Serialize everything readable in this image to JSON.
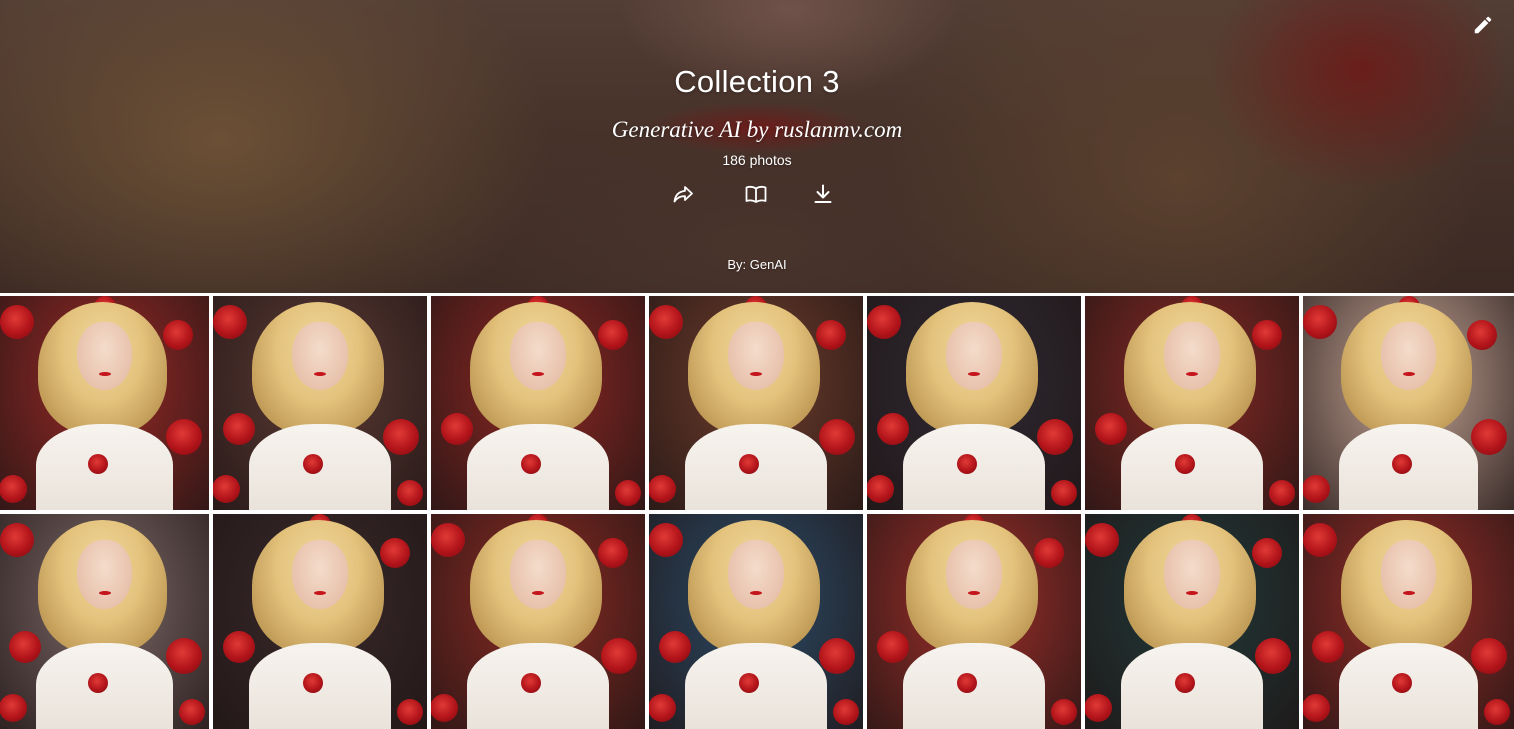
{
  "header": {
    "title": "Collection 3",
    "subtitle": "Generative AI by ruslanmv.com",
    "photo_count": "186 photos",
    "byline": "By: GenAI",
    "actions": [
      {
        "name": "share-icon"
      },
      {
        "name": "open-book-icon"
      },
      {
        "name": "download-icon"
      }
    ],
    "edit_icon": "pencil-icon"
  },
  "colors": {
    "text": "#ffffff",
    "rose_red": "#b2141a",
    "hair_blonde": "#e3c27c",
    "dress_white": "#f3eee8"
  },
  "gallery": {
    "rows": 2,
    "columns": 7,
    "tiles": [
      {
        "bg": "#9b2a26"
      },
      {
        "bg": "#5d3b34"
      },
      {
        "bg": "#8f2823"
      },
      {
        "bg": "#6f3d2c"
      },
      {
        "bg": "#2f2b34"
      },
      {
        "bg": "#8a2a24"
      },
      {
        "bg": "#c9a898"
      },
      {
        "bg": "#7d6a68"
      },
      {
        "bg": "#3a2a2a"
      },
      {
        "bg": "#8d2b23"
      },
      {
        "bg": "#2c4c68"
      },
      {
        "bg": "#a2302a"
      },
      {
        "bg": "#213a3a"
      },
      {
        "bg": "#9a2e28"
      }
    ]
  }
}
